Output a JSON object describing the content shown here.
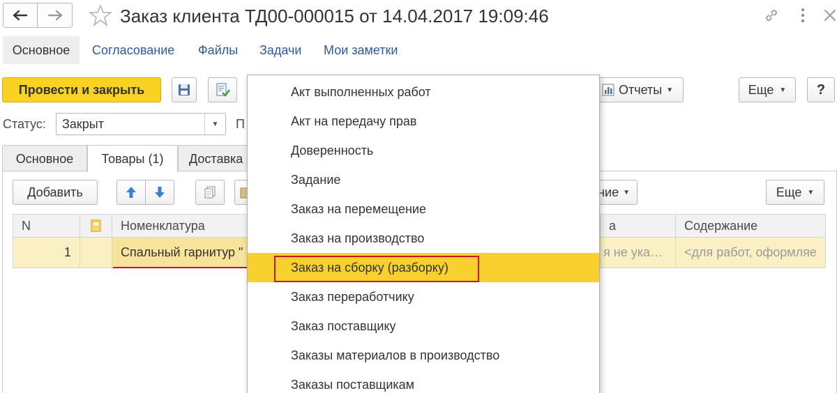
{
  "header": {
    "title": "Заказ клиента ТД00-000015 от 14.04.2017 19:09:46",
    "help_label": "?"
  },
  "nav_tabs": [
    {
      "label": "Основное"
    },
    {
      "label": "Согласование"
    },
    {
      "label": "Файлы"
    },
    {
      "label": "Задачи"
    },
    {
      "label": "Мои заметки"
    }
  ],
  "toolbar": {
    "post_close_label": "Провести и закрыть",
    "reports_label": "Отчеты",
    "more_label": "Еще"
  },
  "status": {
    "label": "Статус:",
    "value": "Закрыт",
    "next_label_fragment": "П"
  },
  "section_tabs": [
    {
      "label": "Основное"
    },
    {
      "label": "Товары (1)"
    },
    {
      "label": "Доставка"
    }
  ],
  "table_toolbar": {
    "add_label": "Добавить",
    "fill_fragment": "ние",
    "more_label": "Еще"
  },
  "table": {
    "columns": [
      "N",
      "",
      "Номенклатура",
      "а",
      "Содержание"
    ],
    "rows": [
      {
        "n": "1",
        "nomenclature": "Спальный гарнитур \"",
        "col4": "я не ука…",
        "content": "<для работ, оформляе"
      }
    ]
  },
  "menu": {
    "items": [
      {
        "label": "Акт выполненных работ"
      },
      {
        "label": "Акт на передачу прав"
      },
      {
        "label": "Доверенность"
      },
      {
        "label": "Задание"
      },
      {
        "label": "Заказ на перемещение"
      },
      {
        "label": "Заказ на производство"
      },
      {
        "label": "Заказ на сборку (разборку)"
      },
      {
        "label": "Заказ переработчику"
      },
      {
        "label": "Заказ поставщику"
      },
      {
        "label": "Заказы материалов в производство"
      },
      {
        "label": "Заказы поставщикам"
      }
    ],
    "selected_index": 6
  },
  "colors": {
    "accent_yellow": "#fad224",
    "menu_highlight": "#f9d12e",
    "link_blue": "#2d5a9b",
    "annotation_red": "#d4141c",
    "row_selected": "#fbf0c4"
  }
}
